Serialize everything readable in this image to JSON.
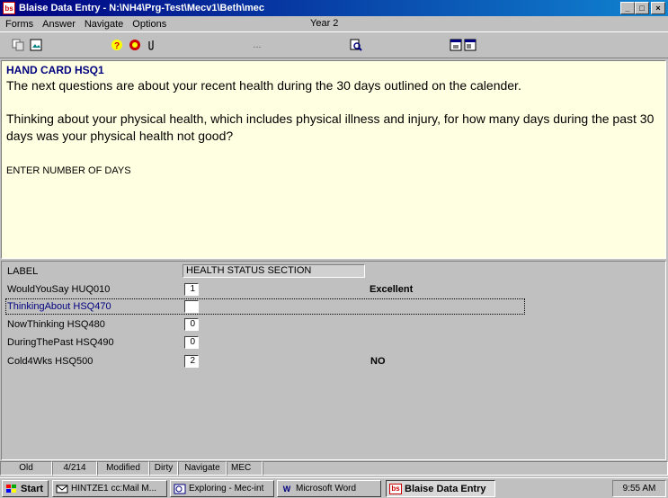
{
  "window": {
    "title": "Blaise Data Entry - N:\\NH4\\Prg-Test\\Mecv1\\Beth\\mec",
    "app_icon": "bs",
    "controls": [
      "_",
      "□",
      "×"
    ]
  },
  "menu": {
    "items": [
      "Forms",
      "Answer",
      "Navigate",
      "Options"
    ],
    "status": "Year 2"
  },
  "toolbar": {
    "icons": [
      "copy-icon",
      "picture-icon",
      "help-icon",
      "stop-icon",
      "attach-icon",
      "ellipsis-icon",
      "search-doc-icon",
      "window-icon",
      "window-alt-icon"
    ],
    "ellipsis": "..."
  },
  "question": {
    "title": "HAND CARD HSQ1",
    "text1": "The next questions are about your recent health during the 30 days outlined on the calender.",
    "text2": "Thinking about your physical health, which includes physical illness and injury, for how many days during the past 30 days was your physical health not good?",
    "instruction": "ENTER NUMBER OF DAYS"
  },
  "form": {
    "label_caption": "LABEL",
    "section": "HEALTH STATUS SECTION",
    "rows": [
      {
        "label": "WouldYouSay HUQ010",
        "value": "1",
        "answer": "Excellent"
      },
      {
        "label": "ThinkingAbout HSQ470",
        "value": "",
        "answer": ""
      },
      {
        "label": "NowThinking HSQ480",
        "value": "0",
        "answer": ""
      },
      {
        "label": "DuringThePast HSQ490",
        "value": "0",
        "answer": ""
      },
      {
        "label": "Cold4Wks HSQ500",
        "value": "2",
        "answer": "NO"
      }
    ],
    "current_row_color": "#000080"
  },
  "statusbar": {
    "cells": [
      "Old",
      "4/214",
      "Modified",
      "Dirty",
      "Navigate",
      "MEC"
    ]
  },
  "taskbar": {
    "start": "Start",
    "tasks": [
      "HINTZE1 cc:Mail M...",
      "Exploring - Mec-int",
      "Microsoft Word",
      "Blaise Data Entry"
    ],
    "clock": "9:55 AM"
  }
}
